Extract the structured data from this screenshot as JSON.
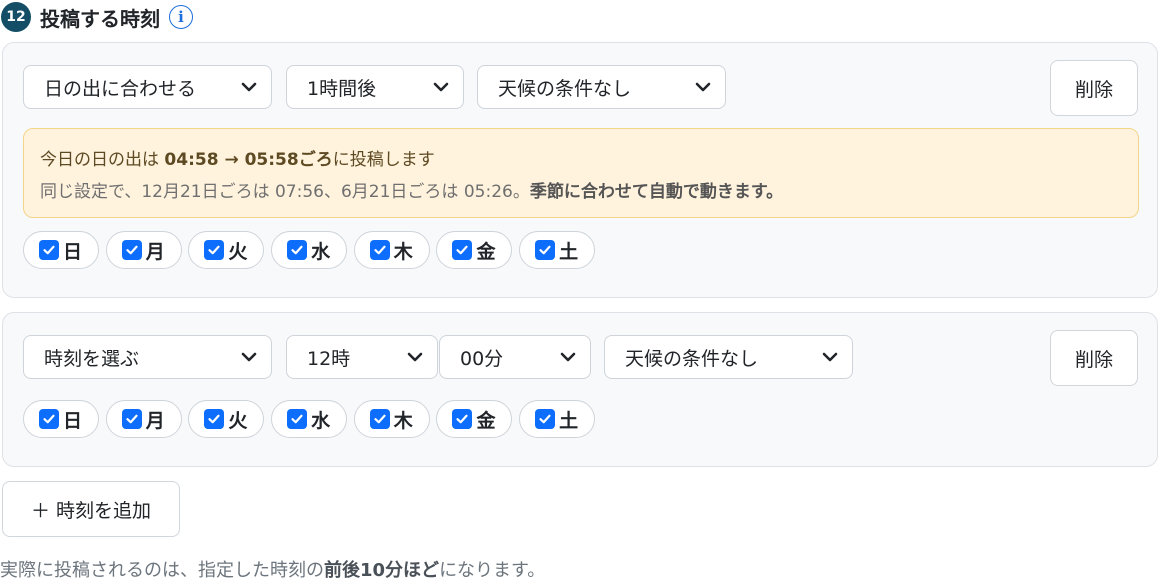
{
  "header": {
    "step_number": "12",
    "title": "投稿する時刻",
    "info_icon": "info-icon"
  },
  "schedules": [
    {
      "base": "日の出に合わせる",
      "offset": "1時間後",
      "weather": "天候の条件なし",
      "delete_label": "削除",
      "notice": {
        "l1_pre": "今日の日の出は ",
        "l1_bold": "04:58 → 05:58ごろ",
        "l1_post": "に投稿します",
        "l2_pre": "同じ設定で、12月21日ごろは 07:56、6月21日ごろは 05:26。",
        "l2_bold": "季節に合わせて自動で動きます。"
      },
      "days": [
        "日",
        "月",
        "火",
        "水",
        "木",
        "金",
        "土"
      ],
      "days_checked": [
        true,
        true,
        true,
        true,
        true,
        true,
        true
      ]
    },
    {
      "base": "時刻を選ぶ",
      "hour": "12時",
      "minute": "00分",
      "weather": "天候の条件なし",
      "delete_label": "削除",
      "days": [
        "日",
        "月",
        "火",
        "水",
        "木",
        "金",
        "土"
      ],
      "days_checked": [
        true,
        true,
        true,
        true,
        true,
        true,
        true
      ]
    }
  ],
  "add_label": "＋ 時刻を追加",
  "footnote": {
    "pre": "実際に投稿されるのは、指定した時刻の",
    "bold": "前後10分ほど",
    "post": "になります。"
  },
  "colors": {
    "primary": "#0d6efd",
    "step_badge": "#134e66",
    "notice_bg": "#fff3de",
    "notice_border": "#f3d58a"
  }
}
